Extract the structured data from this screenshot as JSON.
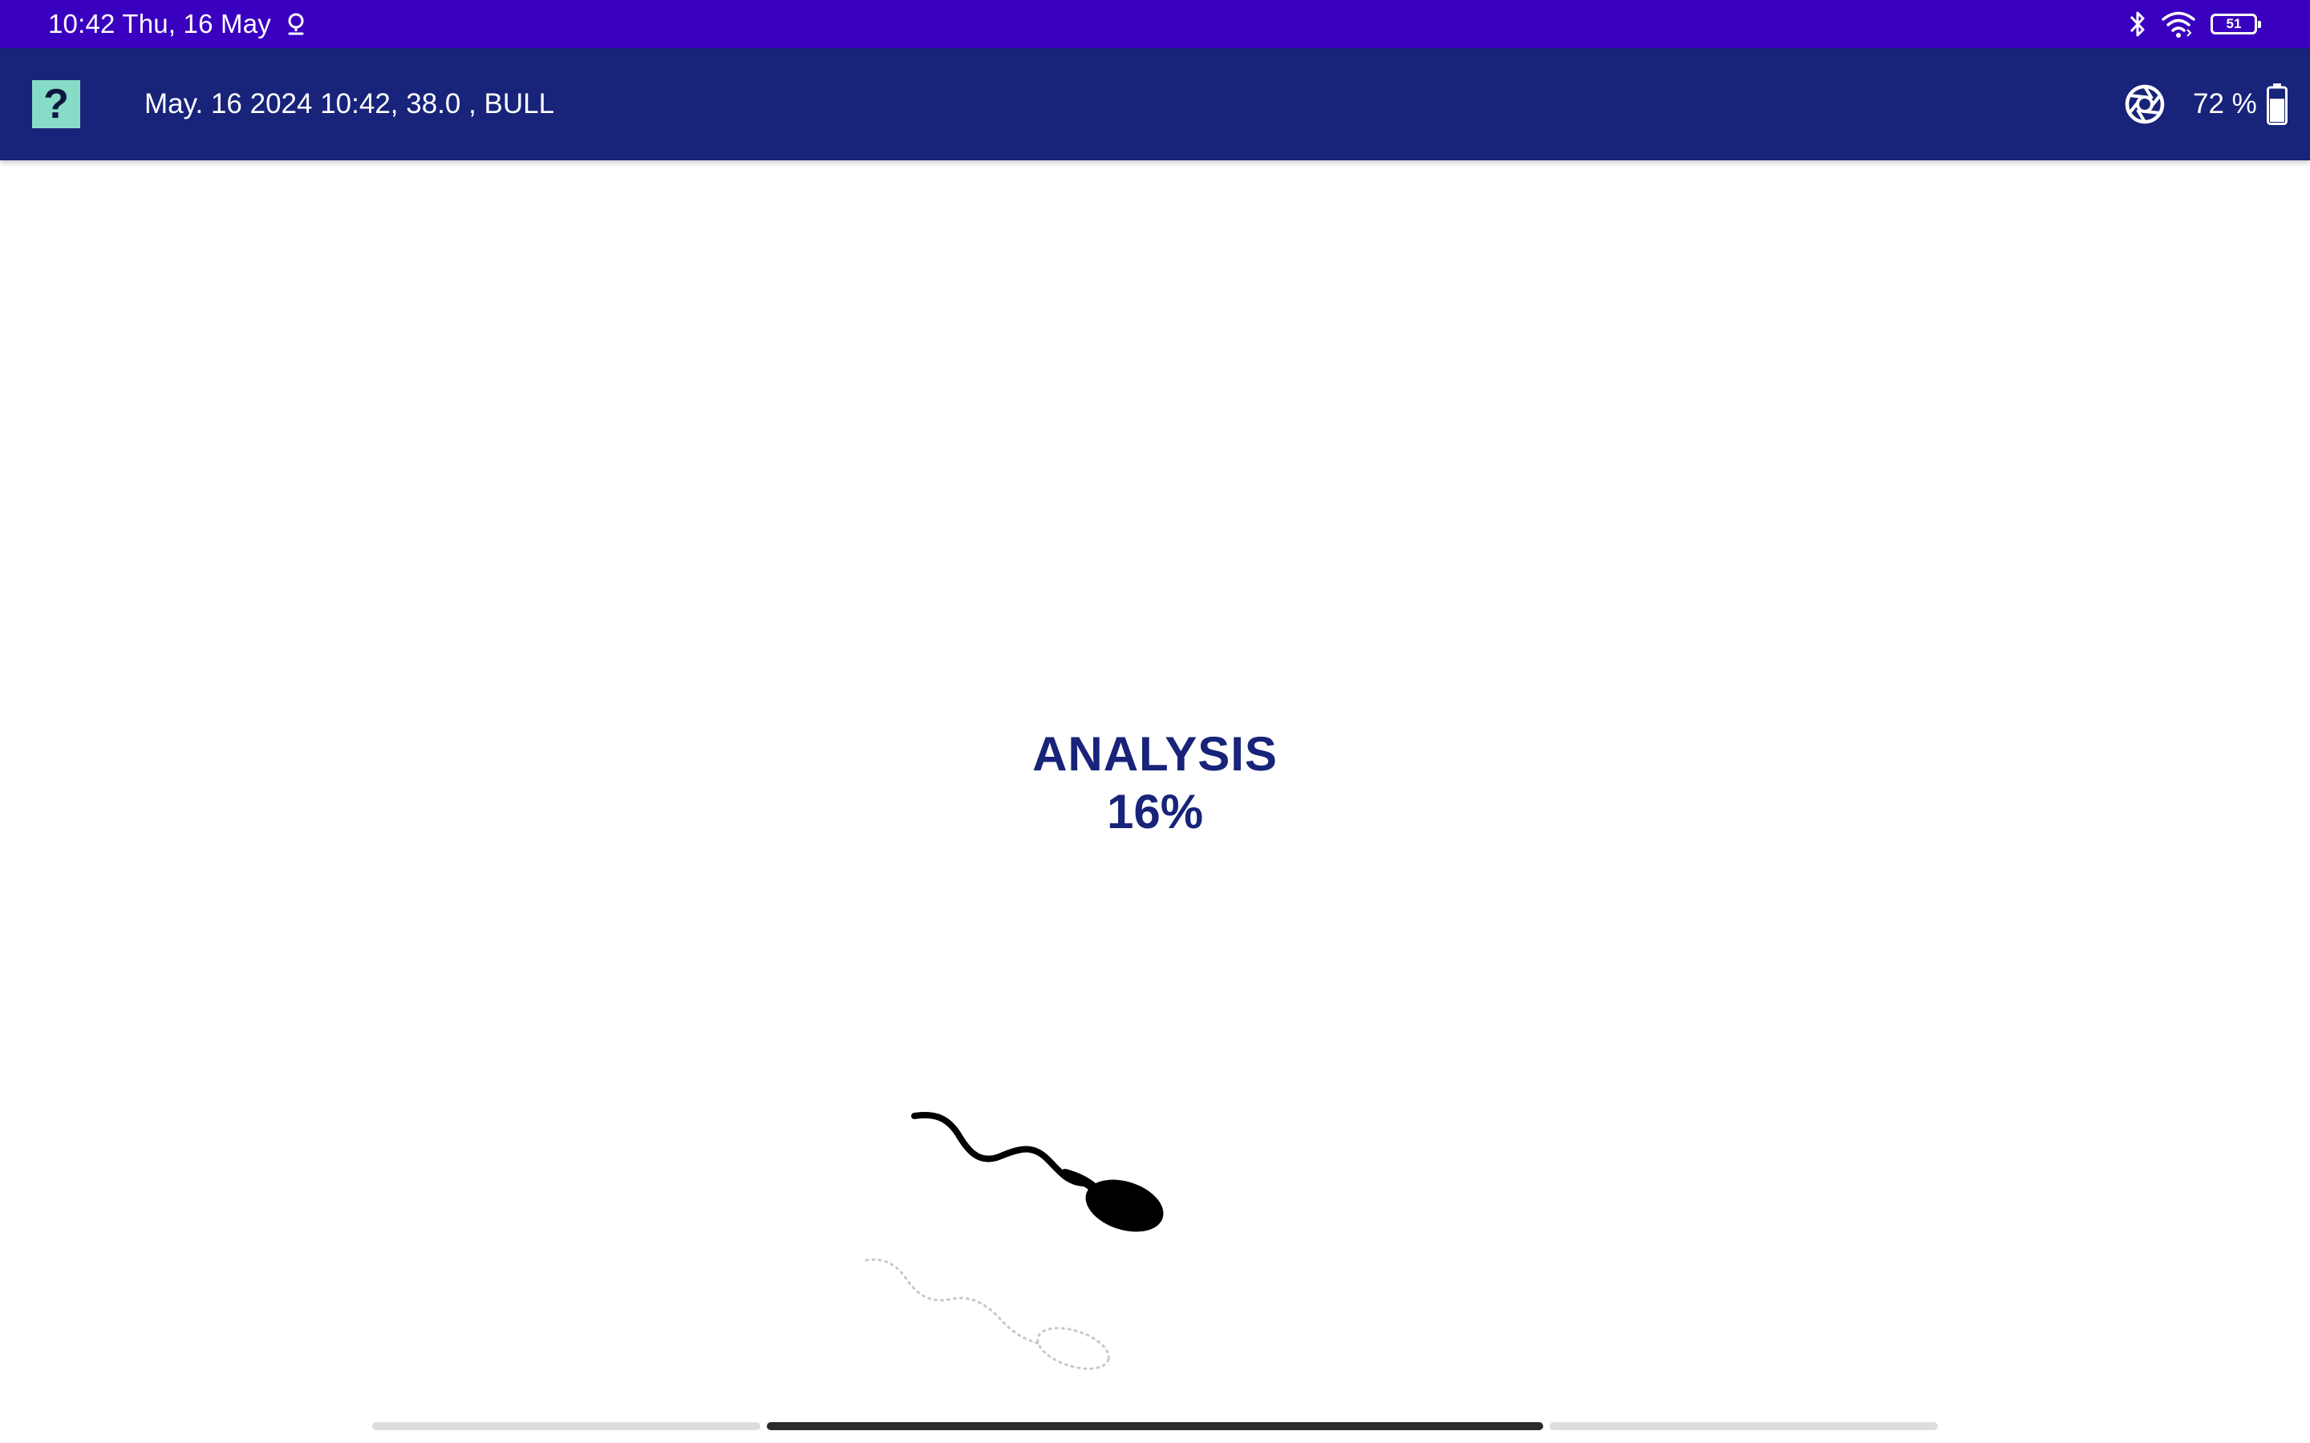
{
  "status_bar": {
    "time_date": "10:42 Thu, 16 May",
    "battery_level": "51",
    "icons": [
      "location-icon",
      "bluetooth-icon",
      "wifi-icon",
      "battery-icon"
    ]
  },
  "app_bar": {
    "help_label": "?",
    "session_info": "May. 16 2024 10:42, 38.0 , BULL",
    "device_battery": "72 %",
    "device_battery_level": 0.72,
    "icons": [
      "aperture-icon",
      "battery-icon"
    ]
  },
  "main": {
    "title": "ANALYSIS",
    "progress": "16%",
    "progress_value": 16
  },
  "colors": {
    "status_bar": "#3a00bf",
    "app_bar": "#18237a",
    "help_button": "#86dcc6",
    "text_primary": "#18237a"
  }
}
